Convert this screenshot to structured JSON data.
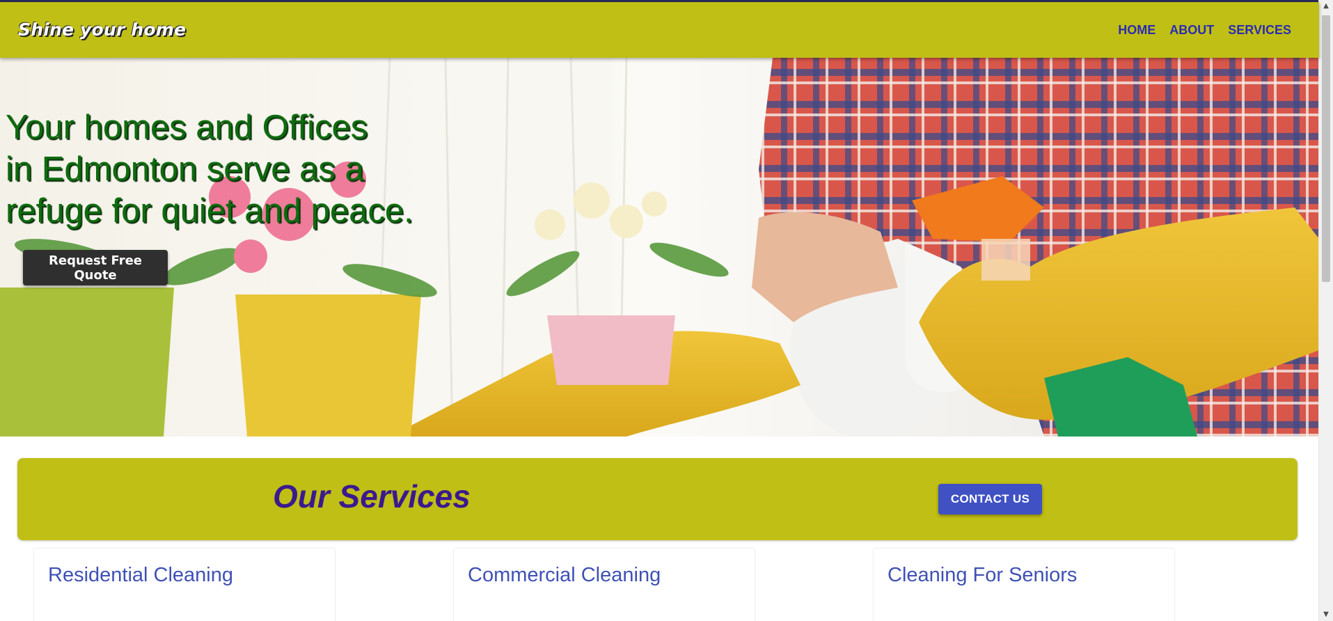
{
  "header": {
    "brand": "Shine your home",
    "nav": [
      "HOME",
      "ABOUT",
      "SERVICES"
    ]
  },
  "hero": {
    "title_lines": [
      "Your homes and Offices",
      "in Edmonton serve as a",
      "refuge for quiet and peace."
    ],
    "cta_label": "Request Free Quote"
  },
  "services": {
    "title": "Our Services",
    "contact_label": "CONTACT US",
    "cards": [
      {
        "title": "Residential Cleaning"
      },
      {
        "title": "Commercial Cleaning"
      },
      {
        "title": "Cleaning For Seniors"
      }
    ]
  },
  "colors": {
    "brand_olive": "#c0bf15",
    "nav_link": "#2a2db0",
    "hero_text": "#0e6b0e",
    "services_title": "#3b1a8e",
    "button_blue": "#3f51c3",
    "card_title": "#3f51b5"
  },
  "icons": {
    "scroll_up": "scroll-up-arrow-icon",
    "scroll_down": "scroll-down-arrow-icon"
  }
}
